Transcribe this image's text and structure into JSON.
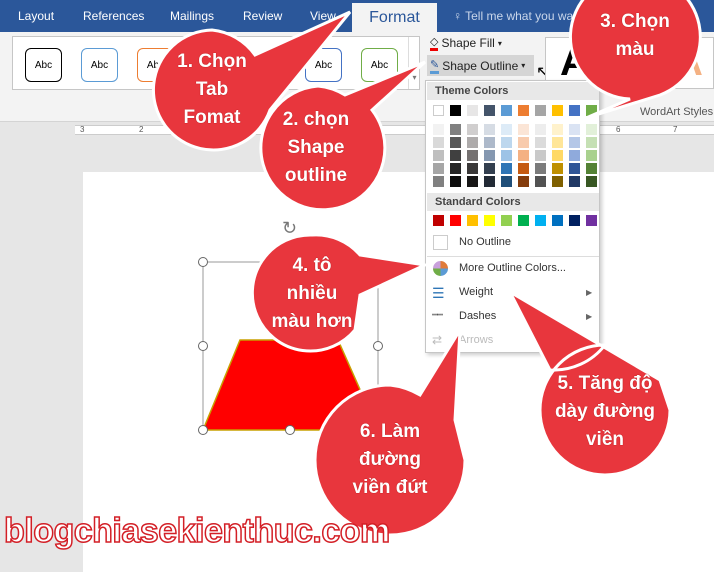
{
  "tabs": [
    "Layout",
    "References",
    "Mailings",
    "Review",
    "View"
  ],
  "active_tab": "Format",
  "tell_me": "Tell me what you want",
  "gallery": {
    "items": [
      "Abc",
      "Abc",
      "Abc",
      "Abc",
      "Abc"
    ],
    "colors": [
      "#000000",
      "#5b9bd5",
      "#ed7d31",
      "#4472c4",
      "#70ad47"
    ]
  },
  "ribbon": {
    "shape_fill": "Shape Fill",
    "shape_outline": "Shape Outline",
    "wordart_letter": "A",
    "wordart_group": "WordArt Styles"
  },
  "ruler": {
    "labels": [
      "3",
      "2",
      "6",
      "7"
    ]
  },
  "menu": {
    "theme_header": "Theme Colors",
    "theme_top": [
      "#ffffff",
      "#000000",
      "#e7e6e6",
      "#44546a",
      "#5b9bd5",
      "#ed7d31",
      "#a5a5a5",
      "#ffc000",
      "#4472c4",
      "#70ad47"
    ],
    "theme_shades": [
      [
        "#f2f2f2",
        "#d9d9d9",
        "#bfbfbf",
        "#a6a6a6",
        "#808080"
      ],
      [
        "#808080",
        "#595959",
        "#404040",
        "#262626",
        "#0d0d0d"
      ],
      [
        "#d0cece",
        "#aeabab",
        "#757171",
        "#3a3838",
        "#171616"
      ],
      [
        "#d6dce4",
        "#adb9ca",
        "#8497b0",
        "#333f4f",
        "#222a35"
      ],
      [
        "#ddebf7",
        "#bdd7ee",
        "#9dc3e6",
        "#2e75b6",
        "#1f4e79"
      ],
      [
        "#fbe5d6",
        "#f8cbad",
        "#f4b183",
        "#c55a11",
        "#843c0c"
      ],
      [
        "#ededed",
        "#dbdbdb",
        "#c9c9c9",
        "#7b7b7b",
        "#525252"
      ],
      [
        "#fff2cc",
        "#ffe699",
        "#ffd966",
        "#bf9000",
        "#7f6000"
      ],
      [
        "#dae3f3",
        "#b4c7e7",
        "#8faadc",
        "#2f5597",
        "#203864"
      ],
      [
        "#e2f0d9",
        "#c5e0b4",
        "#a9d18e",
        "#548235",
        "#385723"
      ]
    ],
    "standard_header": "Standard Colors",
    "standard": [
      "#c00000",
      "#ff0000",
      "#ffc000",
      "#ffff00",
      "#92d050",
      "#00b050",
      "#00b0f0",
      "#0070c0",
      "#002060",
      "#7030a0"
    ],
    "no_outline": "No Outline",
    "more_colors": "More Outline Colors...",
    "weight": "Weight",
    "dashes": "Dashes",
    "arrows": "Arrows"
  },
  "callouts": [
    {
      "lines": [
        "1. Chọn",
        "Tab",
        "Fomat"
      ]
    },
    {
      "lines": [
        "2. chọn",
        "Shape",
        "outline"
      ]
    },
    {
      "lines": [
        "3. Chọn",
        "màu"
      ]
    },
    {
      "lines": [
        "4. tô",
        "nhiều",
        "màu hơn"
      ]
    },
    {
      "lines": [
        "5. Tăng độ",
        "dày đường",
        "viền"
      ]
    },
    {
      "lines": [
        "6. Làm",
        "đường",
        "viền đứt"
      ]
    }
  ],
  "watermark": "blogchiasekienthuc.com",
  "colors": {
    "tabbar": "#2b579a",
    "callout": "#e8363d",
    "triangle": "#ff0000"
  }
}
